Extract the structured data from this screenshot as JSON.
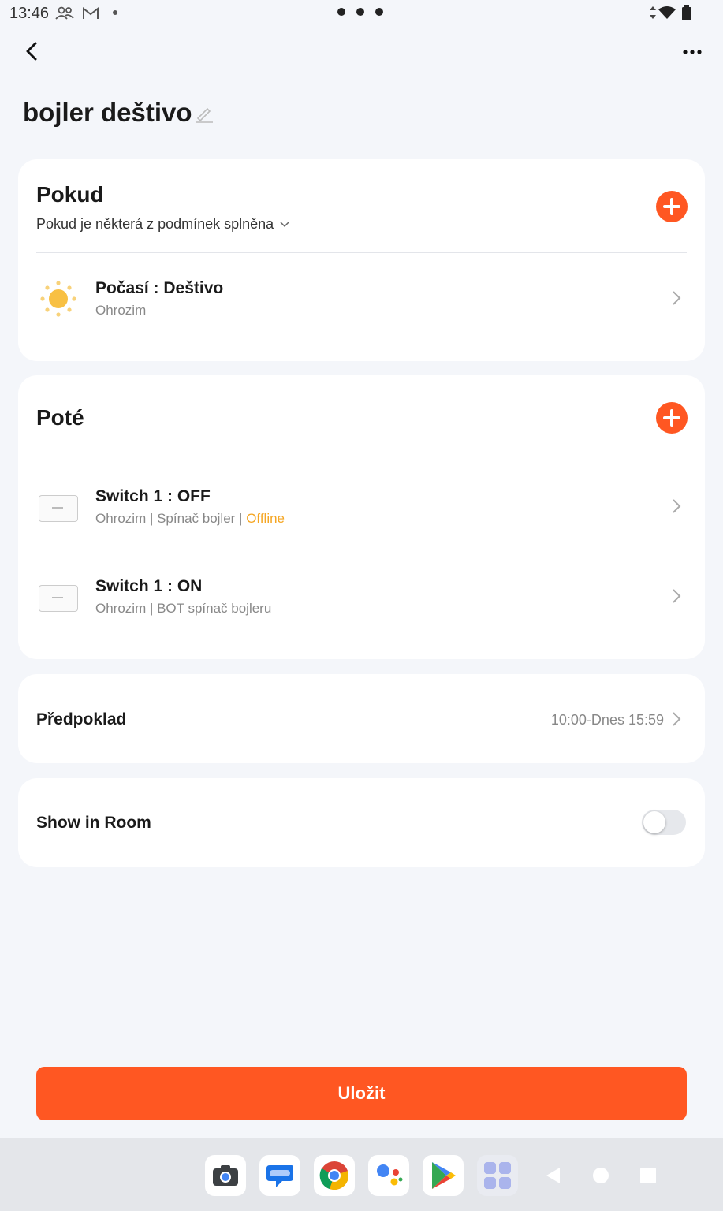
{
  "status_bar": {
    "time": "13:46"
  },
  "header": {
    "title": "bojler deštivo"
  },
  "if_card": {
    "title": "Pokud",
    "condition_mode": "Pokud je některá z podmínek splněna",
    "items": [
      {
        "title": "Počasí : Deštivo",
        "subtitle": "Ohrozim"
      }
    ]
  },
  "then_card": {
    "title": "Poté",
    "items": [
      {
        "title": "Switch 1 : OFF",
        "subtitle": "Ohrozim | Spínač bojler | ",
        "status": "Offline"
      },
      {
        "title": "Switch 1 : ON",
        "subtitle": "Ohrozim | BOT spínač bojleru"
      }
    ]
  },
  "precondition": {
    "label": "Předpoklad",
    "value": "10:00-Dnes 15:59"
  },
  "show_in_room": {
    "label": "Show in Room",
    "enabled": false
  },
  "save_button": {
    "label": "Uložit"
  },
  "colors": {
    "accent": "#ff5722",
    "offline": "#f5a623",
    "background": "#f4f6fa"
  },
  "dock": [
    "camera-icon",
    "messages-icon",
    "chrome-icon",
    "assistant-icon",
    "play-store-icon",
    "app-drawer-icon"
  ]
}
